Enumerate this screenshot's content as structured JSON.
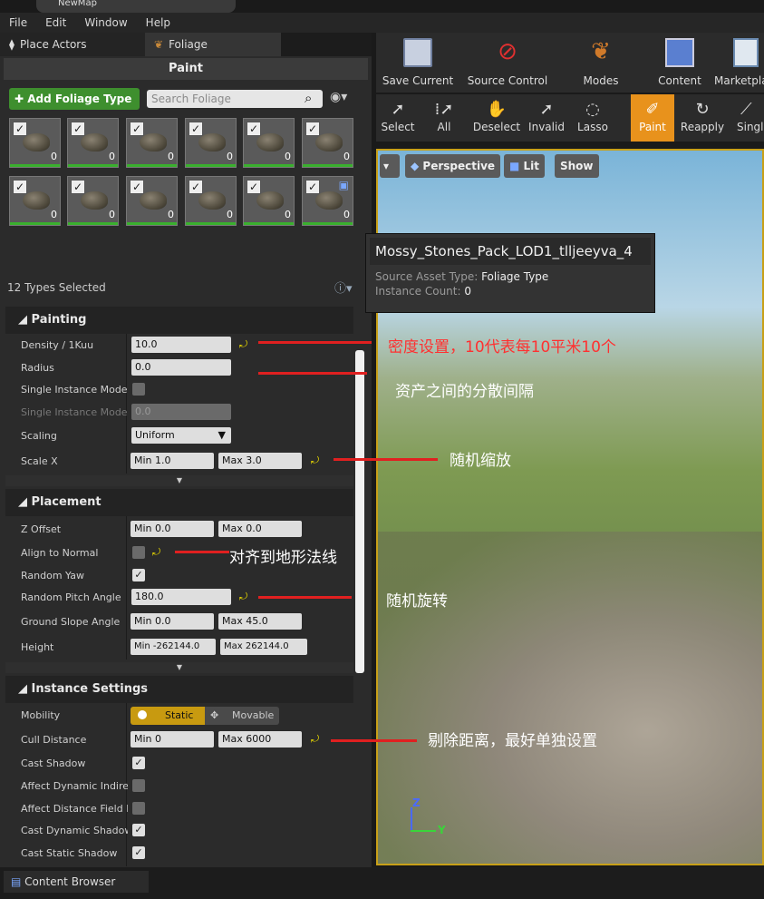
{
  "window": {
    "title_tab": "NewMap"
  },
  "menu": [
    "File",
    "Edit",
    "Window",
    "Help"
  ],
  "left_tabs": [
    {
      "label": "Place Actors"
    },
    {
      "label": "Foliage"
    }
  ],
  "paint_header": "Paint",
  "add_foliage_label": "Add Foliage Type",
  "search": {
    "placeholder": "Search Foliage"
  },
  "tiles": [
    {
      "count": "0"
    },
    {
      "count": "0"
    },
    {
      "count": "0"
    },
    {
      "count": "0"
    },
    {
      "count": "0"
    },
    {
      "count": "0"
    },
    {
      "count": "0"
    },
    {
      "count": "0"
    },
    {
      "count": "0"
    },
    {
      "count": "0"
    },
    {
      "count": "0"
    },
    {
      "count": "0"
    }
  ],
  "types_selected": "12 Types Selected",
  "painting": {
    "title": "Painting",
    "density_label": "Density / 1Kuu",
    "density_value": "10.0",
    "radius_label": "Radius",
    "radius_value": "0.0",
    "single_instance_label": "Single Instance Mode C",
    "single_instance_mode_label": "Single Instance Mode F",
    "single_instance_mode_value": "0.0",
    "scaling_label": "Scaling",
    "scaling_value": "Uniform",
    "scalex_label": "Scale X",
    "scalex_min": "Min  1.0",
    "scalex_max": "Max  3.0"
  },
  "placement": {
    "title": "Placement",
    "zoffset_label": "Z Offset",
    "zoffset_min": "Min  0.0",
    "zoffset_max": "Max  0.0",
    "align_label": "Align to Normal",
    "yaw_label": "Random Yaw",
    "pitch_label": "Random Pitch Angle",
    "pitch_value": "180.0",
    "slope_label": "Ground Slope Angle",
    "slope_min": "Min  0.0",
    "slope_max": "Max  45.0",
    "height_label": "Height",
    "height_min": "Min  -262144.0",
    "height_max": "Max  262144.0"
  },
  "instance": {
    "title": "Instance Settings",
    "mobility_label": "Mobility",
    "mobility_static": "Static",
    "mobility_movable": "Movable",
    "cull_label": "Cull Distance",
    "cull_min": "Min  0",
    "cull_max": "Max  6000",
    "cast_shadow_label": "Cast Shadow",
    "affect_dynamic_label": "Affect Dynamic Indirec",
    "affect_distance_label": "Affect Distance Field Li",
    "cast_dynamic_label": "Cast Dynamic Shadow",
    "cast_static_label": "Cast Static Shadow"
  },
  "toolbar": {
    "save": "Save Current",
    "source": "Source Control",
    "modes": "Modes",
    "content": "Content",
    "marketplace": "Marketplace"
  },
  "tools": {
    "select": "Select",
    "all": "All",
    "deselect": "Deselect",
    "invalid": "Invalid",
    "lasso": "Lasso",
    "paint": "Paint",
    "reapply": "Reapply",
    "single": "Single"
  },
  "viewport": {
    "perspective": "Perspective",
    "lit": "Lit",
    "show": "Show"
  },
  "tooltip": {
    "title": "Mossy_Stones_Pack_LOD1_tlljeeyva_4",
    "source_label": "Source Asset Type:",
    "source_value": "Foliage Type",
    "count_label": "Instance Count:",
    "count_value": "0"
  },
  "annotations": {
    "density": "密度设置，10代表每10平米10个",
    "radius": "资产之间的分散间隔",
    "scale": "随机缩放",
    "align": "对齐到地形法线",
    "rotate": "随机旋转",
    "cull": "剔除距离，最好单独设置"
  },
  "colors": {
    "annotation_red": "#e02020",
    "accent": "#c8a018",
    "add_green": "#3e8f2e"
  },
  "bottom": {
    "content_browser": "Content Browser"
  }
}
